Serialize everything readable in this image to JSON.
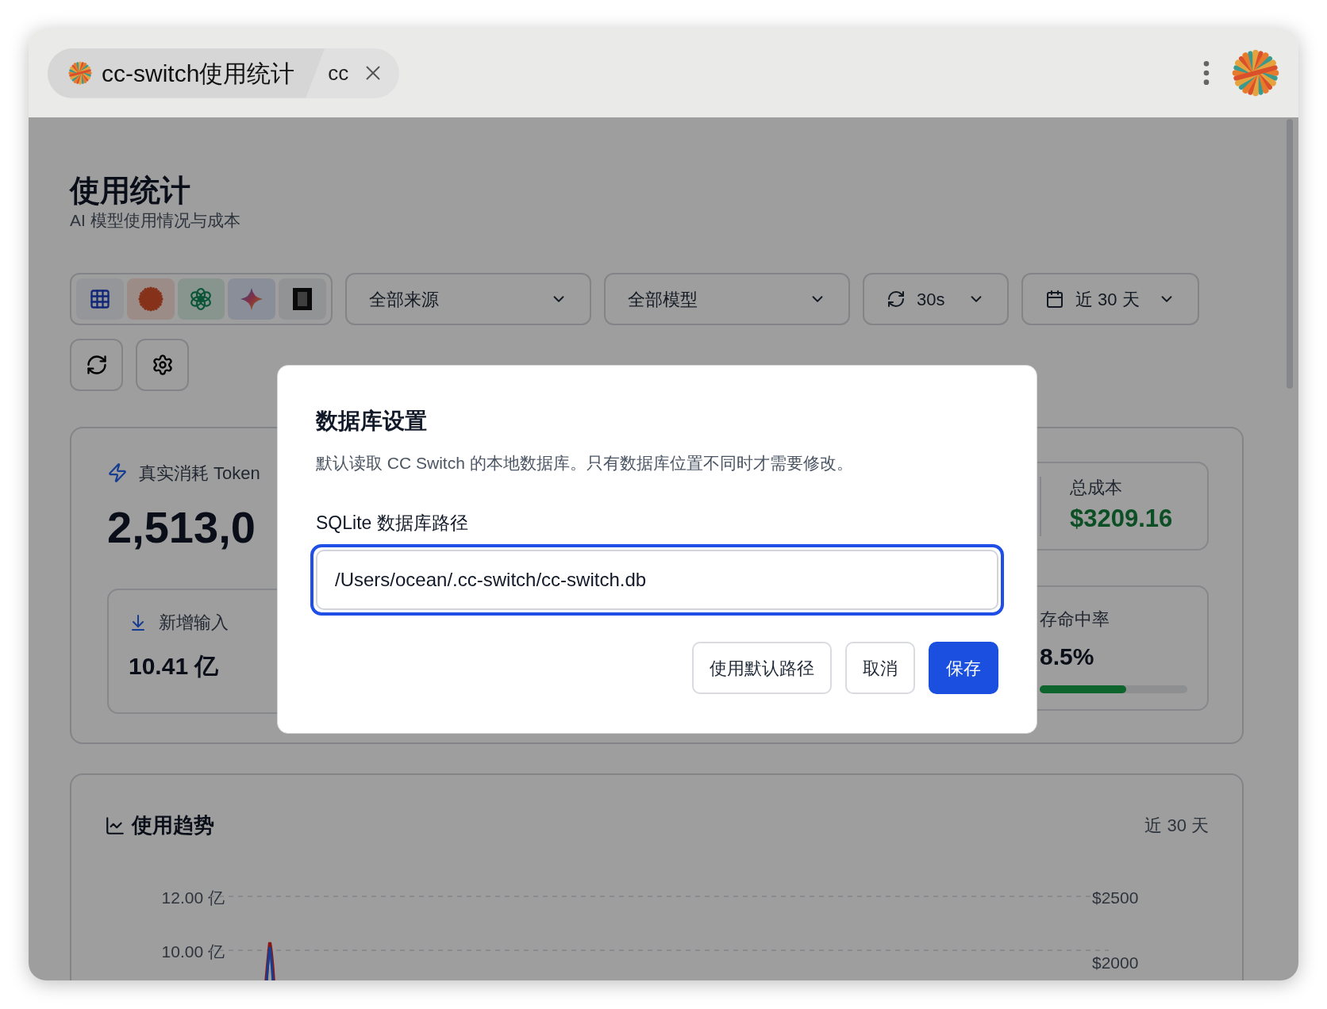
{
  "browser_tab": {
    "active_title": "cc-switch使用统计",
    "next_title": "cc"
  },
  "page": {
    "title": "使用统计",
    "subtitle": "AI 模型使用情况与成本"
  },
  "toolbar": {
    "source_filter": "全部来源",
    "model_filter": "全部模型",
    "refresh_interval": "30s",
    "date_range": "近 30 天"
  },
  "stats": {
    "tokens_label": "真实消耗 Token",
    "tokens_value": "2,513,0",
    "input": {
      "label": "新增输入",
      "value": "10.41 亿"
    },
    "cost": {
      "label": "总成本",
      "value": "$3209.16"
    },
    "cache_hit": {
      "label": "存命中率",
      "value": "8.5%",
      "level": 0.585
    }
  },
  "trend": {
    "title": "使用趋势",
    "range": "近 30 天",
    "left_ticks": [
      "12.00 亿",
      "10.00 亿"
    ],
    "right_ticks": [
      "$2500",
      "$2000"
    ]
  },
  "dialog": {
    "title": "数据库设置",
    "description": "默认读取 CC Switch 的本地数据库。只有数据库位置不同时才需要修改。",
    "field_label": "SQLite 数据库路径",
    "field_value": "/Users/ocean/.cc-switch/cc-switch.db",
    "buttons": [
      {
        "label": "使用默认路径",
        "kind": "secondary"
      },
      {
        "label": "取消",
        "kind": "secondary"
      },
      {
        "label": "保存",
        "kind": "primary"
      }
    ]
  }
}
